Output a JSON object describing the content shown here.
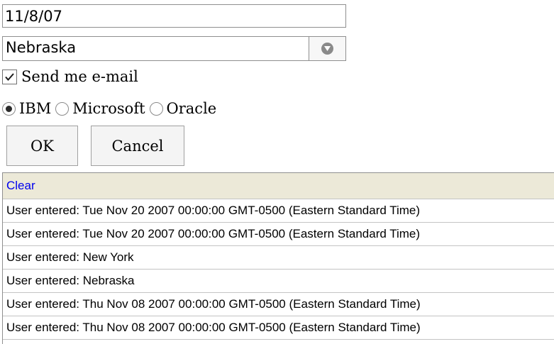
{
  "form": {
    "date_value": "11/8/07",
    "state_value": "Nebraska",
    "email_label": "Send me e-mail",
    "email_checked": true,
    "radio_options": [
      {
        "label": "IBM",
        "checked": true
      },
      {
        "label": "Microsoft",
        "checked": false
      },
      {
        "label": "Oracle",
        "checked": false
      }
    ],
    "ok_label": "OK",
    "cancel_label": "Cancel"
  },
  "log": {
    "clear_label": "Clear",
    "entries": [
      "User entered: Tue Nov 20 2007 00:00:00 GMT-0500 (Eastern Standard Time)",
      "User entered: Tue Nov 20 2007 00:00:00 GMT-0500 (Eastern Standard Time)",
      "User entered: New York",
      "User entered: Nebraska",
      "User entered: Thu Nov 08 2007 00:00:00 GMT-0500 (Eastern Standard Time)",
      "User entered: Thu Nov 08 2007 00:00:00 GMT-0500 (Eastern Standard Time)"
    ]
  },
  "icons": {
    "dropdown": "chevron-down-icon",
    "checkbox_mark": "checkmark-icon"
  },
  "colors": {
    "link": "#0000ee",
    "log_header_bg": "#ece9d8"
  }
}
